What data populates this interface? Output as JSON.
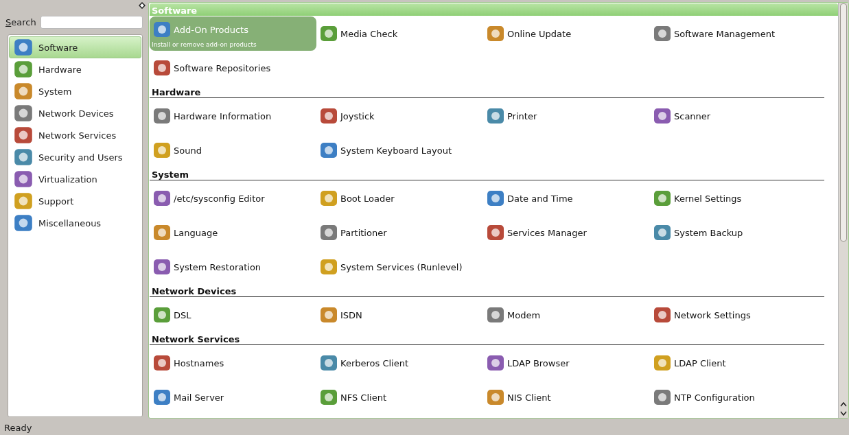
{
  "sidebar": {
    "search": {
      "label": "Search"
    },
    "items": [
      {
        "label": "Software",
        "selected": true
      },
      {
        "label": "Hardware",
        "selected": false
      },
      {
        "label": "System",
        "selected": false
      },
      {
        "label": "Network Devices",
        "selected": false
      },
      {
        "label": "Network Services",
        "selected": false
      },
      {
        "label": "Security and Users",
        "selected": false
      },
      {
        "label": "Virtualization",
        "selected": false
      },
      {
        "label": "Support",
        "selected": false
      },
      {
        "label": "Miscellaneous",
        "selected": false
      }
    ]
  },
  "sections": [
    {
      "title": "Software",
      "selected": true,
      "items": [
        {
          "label": "Add-On Products",
          "selected": true,
          "description": "Install or remove add-on products"
        },
        {
          "label": "Media Check",
          "selected": false
        },
        {
          "label": "Online Update",
          "selected": false
        },
        {
          "label": "Software Management",
          "selected": false
        },
        {
          "label": "Software Repositories",
          "selected": false
        }
      ]
    },
    {
      "title": "Hardware",
      "selected": false,
      "items": [
        {
          "label": "Hardware Information",
          "selected": false
        },
        {
          "label": "Joystick",
          "selected": false
        },
        {
          "label": "Printer",
          "selected": false
        },
        {
          "label": "Scanner",
          "selected": false
        },
        {
          "label": "Sound",
          "selected": false
        },
        {
          "label": "System Keyboard Layout",
          "selected": false
        }
      ]
    },
    {
      "title": "System",
      "selected": false,
      "items": [
        {
          "label": "/etc/sysconfig Editor",
          "selected": false
        },
        {
          "label": "Boot Loader",
          "selected": false
        },
        {
          "label": "Date and Time",
          "selected": false
        },
        {
          "label": "Kernel Settings",
          "selected": false
        },
        {
          "label": "Language",
          "selected": false
        },
        {
          "label": "Partitioner",
          "selected": false
        },
        {
          "label": "Services Manager",
          "selected": false
        },
        {
          "label": "System Backup",
          "selected": false
        },
        {
          "label": "System Restoration",
          "selected": false
        },
        {
          "label": "System Services (Runlevel)",
          "selected": false
        }
      ]
    },
    {
      "title": "Network Devices",
      "selected": false,
      "items": [
        {
          "label": "DSL",
          "selected": false
        },
        {
          "label": "ISDN",
          "selected": false
        },
        {
          "label": "Modem",
          "selected": false
        },
        {
          "label": "Network Settings",
          "selected": false
        }
      ]
    },
    {
      "title": "Network Services",
      "selected": false,
      "items": [
        {
          "label": "Hostnames",
          "selected": false
        },
        {
          "label": "Kerberos Client",
          "selected": false
        },
        {
          "label": "LDAP Browser",
          "selected": false
        },
        {
          "label": "LDAP Client",
          "selected": false
        },
        {
          "label": "Mail Server",
          "selected": false
        },
        {
          "label": "NFS Client",
          "selected": false
        },
        {
          "label": "NIS Client",
          "selected": false
        },
        {
          "label": "NTP Configuration",
          "selected": false
        }
      ]
    }
  ],
  "status_bar": "Ready"
}
